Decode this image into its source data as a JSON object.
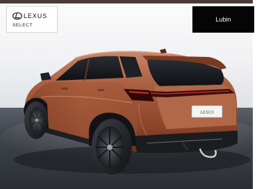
{
  "brand": {
    "logo_text": "LEXUS",
    "program_label": "SELECT"
  },
  "location": {
    "label": "Lubin"
  },
  "vehicle": {
    "plate_text": "LEXUS"
  },
  "colors": {
    "body_paint": "#a55a3a",
    "backdrop": "#e9ebee",
    "floor": "#3b4048",
    "location_badge_bg": "#050505",
    "location_badge_text": "#ffffff"
  }
}
